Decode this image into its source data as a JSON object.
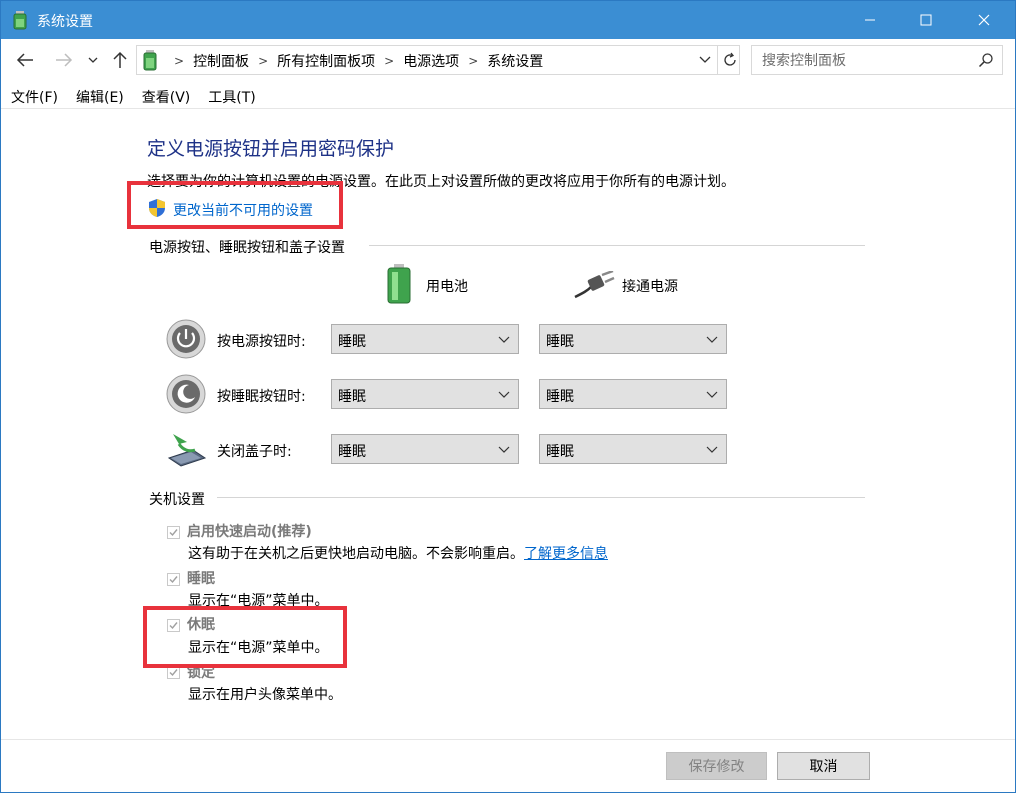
{
  "window": {
    "title": "系统设置"
  },
  "address": {
    "crumbs": [
      "控制面板",
      "所有控制面板项",
      "电源选项",
      "系统设置"
    ]
  },
  "search": {
    "placeholder": "搜索控制面板"
  },
  "menu": [
    "文件(F)",
    "编辑(E)",
    "查看(V)",
    "工具(T)"
  ],
  "page": {
    "heading": "定义电源按钮并启用密码保护",
    "description": "选择要为你的计算机设置的电源设置。在此页上对设置所做的更改将应用于你所有的电源计划。",
    "change_link": "更改当前不可用的设置"
  },
  "power_buttons": {
    "section_title": "电源按钮、睡眠按钮和盖子设置",
    "col_battery": "用电池",
    "col_ac": "接通电源",
    "rows": [
      {
        "label": "按电源按钮时:",
        "battery": "睡眠",
        "ac": "睡眠"
      },
      {
        "label": "按睡眠按钮时:",
        "battery": "睡眠",
        "ac": "睡眠"
      },
      {
        "label": "关闭盖子时:",
        "battery": "睡眠",
        "ac": "睡眠"
      }
    ]
  },
  "shutdown": {
    "section_title": "关机设置",
    "items": [
      {
        "label": "启用快速启动(推荐)",
        "desc": "这有助于在关机之后更快地启动电脑。不会影响重启。",
        "link": "了解更多信息",
        "checked": true
      },
      {
        "label": "睡眠",
        "desc": "显示在“电源”菜单中。",
        "checked": true
      },
      {
        "label": "休眠",
        "desc": "显示在“电源”菜单中。",
        "checked": true
      },
      {
        "label": "锁定",
        "desc": "显示在用户头像菜单中。",
        "checked": true
      }
    ]
  },
  "buttons": {
    "save": "保存修改",
    "cancel": "取消"
  },
  "colors": {
    "titlebar": "#3b8ed3",
    "heading": "#1e3287",
    "link": "#0066cc",
    "highlight": "#e8323c"
  }
}
